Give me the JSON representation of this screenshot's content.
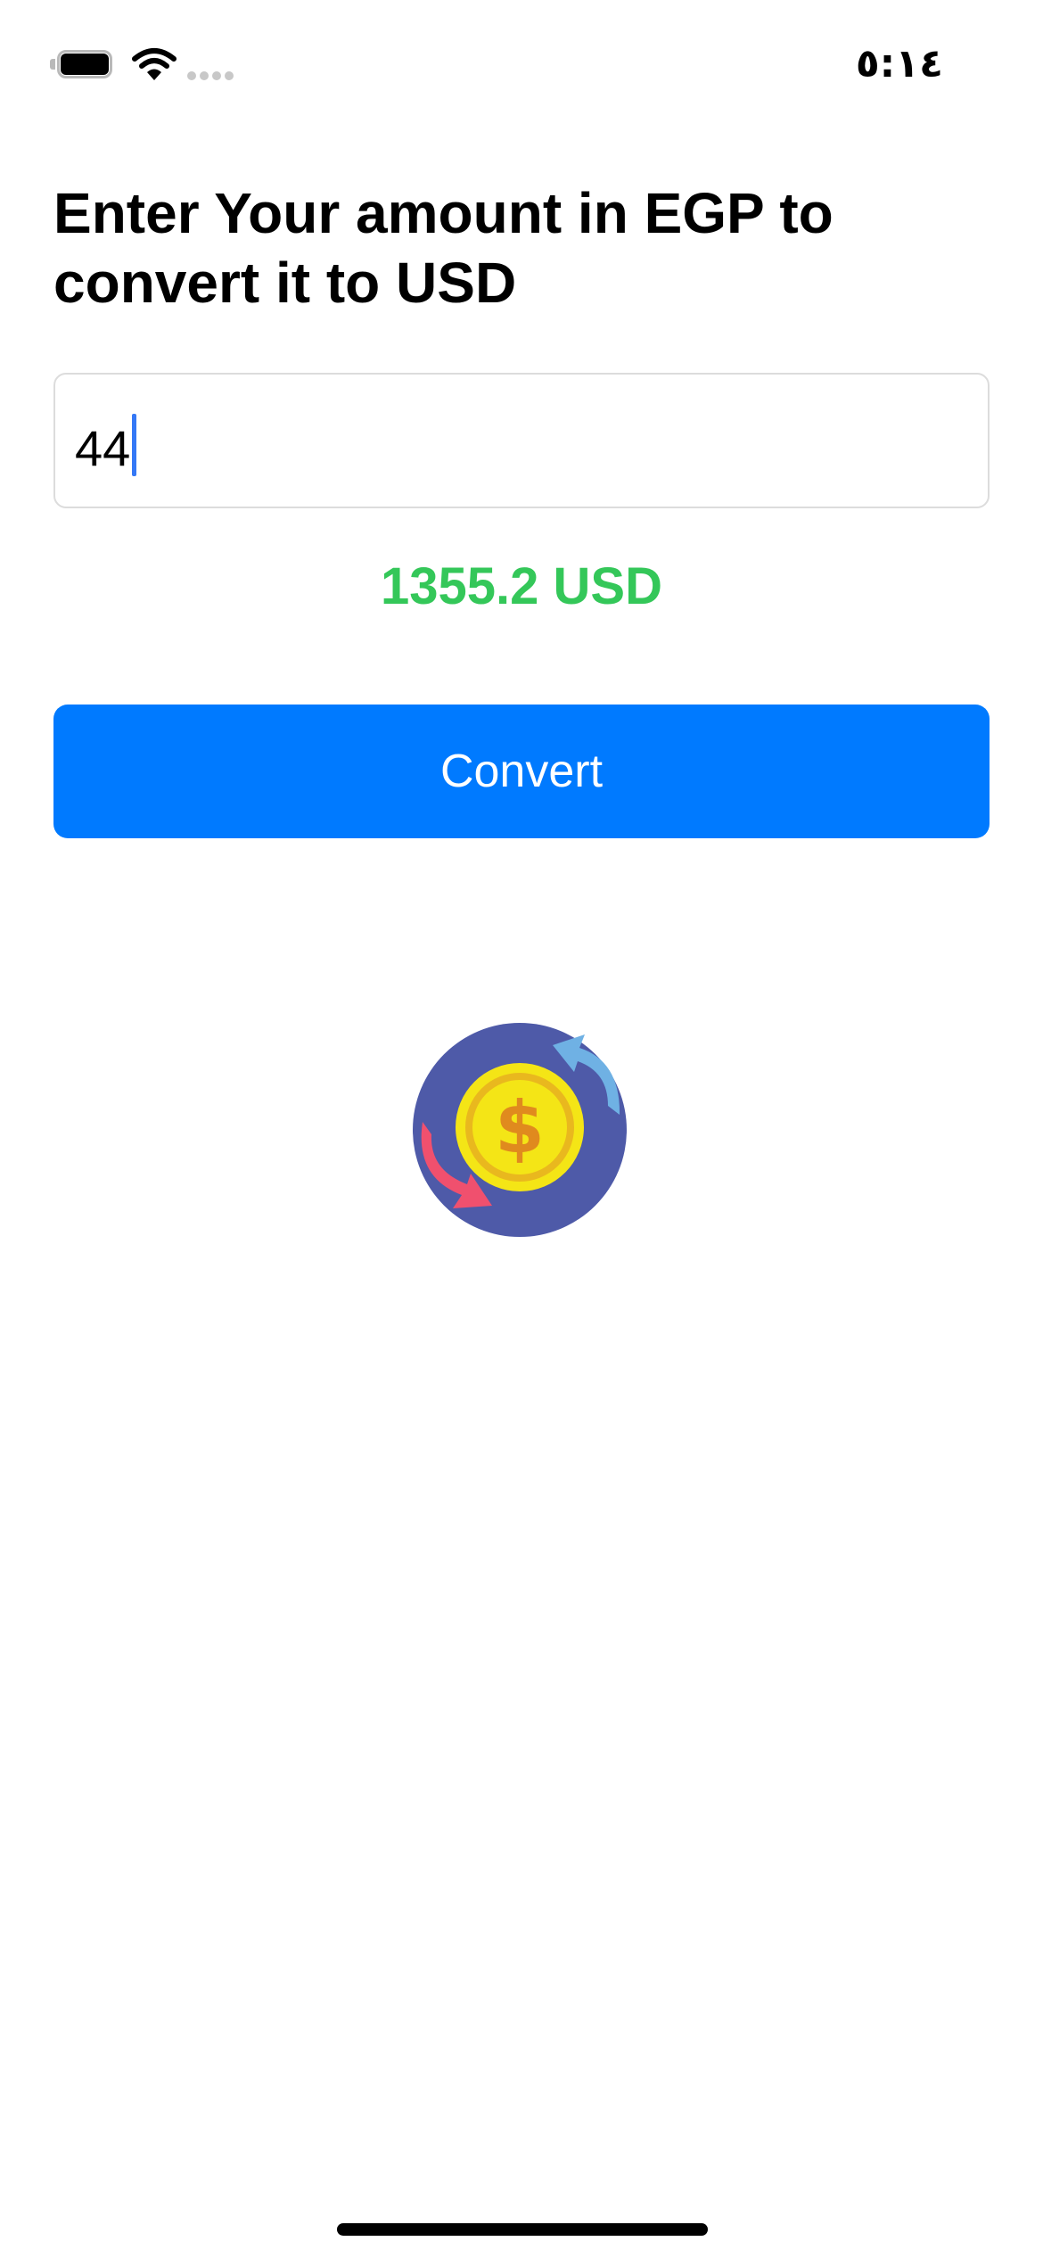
{
  "status_bar": {
    "time": "٥:١٤",
    "icons": [
      "battery-icon",
      "wifi-icon",
      "signal-icon"
    ]
  },
  "screen": {
    "heading": "Enter Your amount in EGP to convert it to USD",
    "amount_input": {
      "value": "44"
    },
    "result_text": "1355.2 USD",
    "convert_button_label": "Convert",
    "illustration": "currency-exchange-icon"
  },
  "colors": {
    "accent": "#007aff",
    "result": "#34c759",
    "caret": "#3478f6",
    "illustration_circle": "#4e5aa8",
    "coin": "#f4e516",
    "coin_ring": "#e9b81e",
    "arrow_blue": "#6fb1e4",
    "arrow_red": "#f0506e"
  }
}
